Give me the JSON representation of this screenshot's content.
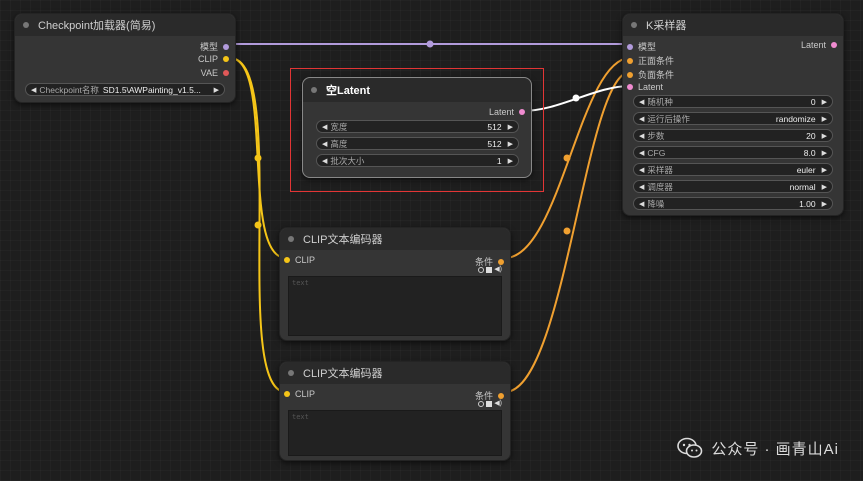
{
  "nodes": {
    "checkpoint": {
      "title": "Checkpoint加载器(简易)",
      "outputs": [
        "模型",
        "CLIP",
        "VAE"
      ],
      "widget": {
        "label": "Checkpoint名称",
        "value": "SD1.5\\AWPainting_v1.5..."
      }
    },
    "empty_latent": {
      "title": "空Latent",
      "output": "Latent",
      "widgets": [
        {
          "label": "宽度",
          "value": "512"
        },
        {
          "label": "高度",
          "value": "512"
        },
        {
          "label": "批次大小",
          "value": "1"
        }
      ]
    },
    "ksampler": {
      "title": "K采样器",
      "inputs": [
        "模型",
        "正面条件",
        "负面条件",
        "Latent"
      ],
      "output": "Latent",
      "widgets": [
        {
          "label": "随机种",
          "value": "0"
        },
        {
          "label": "运行后操作",
          "value": "randomize"
        },
        {
          "label": "步数",
          "value": "20"
        },
        {
          "label": "CFG",
          "value": "8.0"
        },
        {
          "label": "采样器",
          "value": "euler"
        },
        {
          "label": "调度器",
          "value": "normal"
        },
        {
          "label": "降噪",
          "value": "1.00"
        }
      ]
    },
    "clip_encode_1": {
      "title": "CLIP文本编码器",
      "input": "CLIP",
      "output": "条件",
      "placeholder": "text"
    },
    "clip_encode_2": {
      "title": "CLIP文本编码器",
      "input": "CLIP",
      "output": "条件",
      "placeholder": "text"
    }
  },
  "colors": {
    "model_wire": "#b29bdc",
    "clip_wire": "#f5c518",
    "cond_wire": "#f0a030",
    "latent_wire": "#ffffff",
    "vae_port": "#e05858",
    "latent_port": "#f08bd0",
    "highlight": "#e23535"
  },
  "watermark": {
    "text": "公众号 · 画青山Ai",
    "icon": "wechat-icon"
  }
}
